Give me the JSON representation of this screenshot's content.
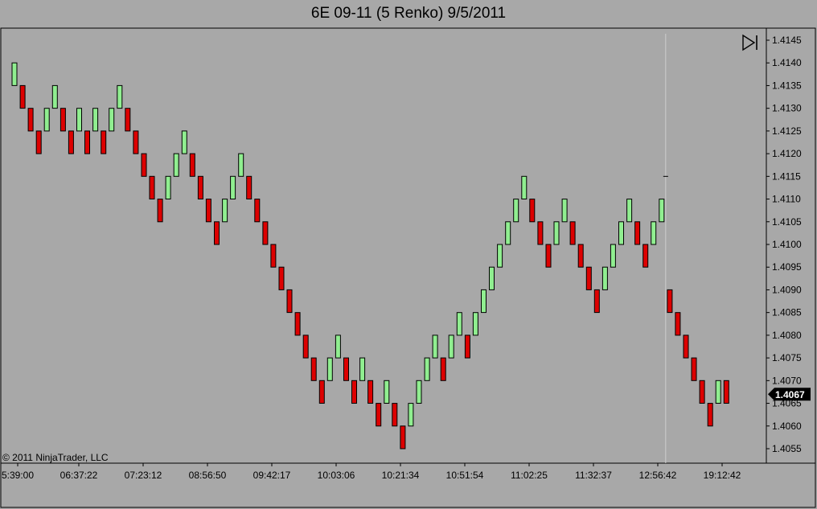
{
  "title": "6E 09-11 (5 Renko)  9/5/2011",
  "copyright": "© 2011 NinjaTrader, LLC",
  "colors": {
    "background": "#a8a8a8",
    "up_brick": "#90ee90",
    "down_brick": "#dd0000",
    "outline": "#000000",
    "price_marker_bg": "#000000",
    "price_marker_text": "#ffffff"
  },
  "icons": {
    "scroll_end": "scroll-to-end-icon"
  },
  "chart_data": {
    "type": "renko",
    "brick_size": 0.0005,
    "ylim": [
      1.4052,
      1.4147
    ],
    "y_ticks": [
      "1.4145",
      "1.4140",
      "1.4135",
      "1.4130",
      "1.4125",
      "1.4120",
      "1.4115",
      "1.4110",
      "1.4105",
      "1.4100",
      "1.4095",
      "1.4090",
      "1.4085",
      "1.4080",
      "1.4075",
      "1.4070",
      "1.4065",
      "1.4060",
      "1.4055"
    ],
    "x_ticks": [
      "5:39:00",
      "06:37:22",
      "07:23:12",
      "08:56:50",
      "09:42:17",
      "10:03:06",
      "10:21:34",
      "10:51:54",
      "11:02:25",
      "11:32:37",
      "12:56:42",
      "19:12:42"
    ],
    "session_break_after_brick": 81,
    "last_price": "1.4067",
    "bricks": [
      {
        "low": 1.4135,
        "high": 1.414,
        "dir": "up"
      },
      {
        "low": 1.413,
        "high": 1.4135,
        "dir": "down"
      },
      {
        "low": 1.4125,
        "high": 1.413,
        "dir": "down"
      },
      {
        "low": 1.412,
        "high": 1.4125,
        "dir": "down"
      },
      {
        "low": 1.4125,
        "high": 1.413,
        "dir": "up"
      },
      {
        "low": 1.413,
        "high": 1.4135,
        "dir": "up"
      },
      {
        "low": 1.4125,
        "high": 1.413,
        "dir": "down"
      },
      {
        "low": 1.412,
        "high": 1.4125,
        "dir": "down"
      },
      {
        "low": 1.4125,
        "high": 1.413,
        "dir": "up"
      },
      {
        "low": 1.412,
        "high": 1.4125,
        "dir": "down"
      },
      {
        "low": 1.4125,
        "high": 1.413,
        "dir": "up"
      },
      {
        "low": 1.412,
        "high": 1.4125,
        "dir": "down"
      },
      {
        "low": 1.4125,
        "high": 1.413,
        "dir": "up"
      },
      {
        "low": 1.413,
        "high": 1.4135,
        "dir": "up"
      },
      {
        "low": 1.4125,
        "high": 1.413,
        "dir": "down"
      },
      {
        "low": 1.412,
        "high": 1.4125,
        "dir": "down"
      },
      {
        "low": 1.4115,
        "high": 1.412,
        "dir": "down"
      },
      {
        "low": 1.411,
        "high": 1.4115,
        "dir": "down"
      },
      {
        "low": 1.4105,
        "high": 1.411,
        "dir": "down"
      },
      {
        "low": 1.411,
        "high": 1.4115,
        "dir": "up"
      },
      {
        "low": 1.4115,
        "high": 1.412,
        "dir": "up"
      },
      {
        "low": 1.412,
        "high": 1.4125,
        "dir": "up"
      },
      {
        "low": 1.4115,
        "high": 1.412,
        "dir": "down"
      },
      {
        "low": 1.411,
        "high": 1.4115,
        "dir": "down"
      },
      {
        "low": 1.4105,
        "high": 1.411,
        "dir": "down"
      },
      {
        "low": 1.41,
        "high": 1.4105,
        "dir": "down"
      },
      {
        "low": 1.4105,
        "high": 1.411,
        "dir": "up"
      },
      {
        "low": 1.411,
        "high": 1.4115,
        "dir": "up"
      },
      {
        "low": 1.4115,
        "high": 1.412,
        "dir": "up"
      },
      {
        "low": 1.411,
        "high": 1.4115,
        "dir": "down"
      },
      {
        "low": 1.4105,
        "high": 1.411,
        "dir": "down"
      },
      {
        "low": 1.41,
        "high": 1.4105,
        "dir": "down"
      },
      {
        "low": 1.4095,
        "high": 1.41,
        "dir": "down"
      },
      {
        "low": 1.409,
        "high": 1.4095,
        "dir": "down"
      },
      {
        "low": 1.4085,
        "high": 1.409,
        "dir": "down"
      },
      {
        "low": 1.408,
        "high": 1.4085,
        "dir": "down"
      },
      {
        "low": 1.4075,
        "high": 1.408,
        "dir": "down"
      },
      {
        "low": 1.407,
        "high": 1.4075,
        "dir": "down"
      },
      {
        "low": 1.4065,
        "high": 1.407,
        "dir": "down"
      },
      {
        "low": 1.407,
        "high": 1.4075,
        "dir": "up"
      },
      {
        "low": 1.4075,
        "high": 1.408,
        "dir": "up"
      },
      {
        "low": 1.407,
        "high": 1.4075,
        "dir": "down"
      },
      {
        "low": 1.4065,
        "high": 1.407,
        "dir": "down"
      },
      {
        "low": 1.407,
        "high": 1.4075,
        "dir": "up"
      },
      {
        "low": 1.4065,
        "high": 1.407,
        "dir": "down"
      },
      {
        "low": 1.406,
        "high": 1.4065,
        "dir": "down"
      },
      {
        "low": 1.4065,
        "high": 1.407,
        "dir": "up"
      },
      {
        "low": 1.406,
        "high": 1.4065,
        "dir": "down"
      },
      {
        "low": 1.4055,
        "high": 1.406,
        "dir": "down"
      },
      {
        "low": 1.406,
        "high": 1.4065,
        "dir": "up"
      },
      {
        "low": 1.4065,
        "high": 1.407,
        "dir": "up"
      },
      {
        "low": 1.407,
        "high": 1.4075,
        "dir": "up"
      },
      {
        "low": 1.4075,
        "high": 1.408,
        "dir": "up"
      },
      {
        "low": 1.407,
        "high": 1.4075,
        "dir": "down"
      },
      {
        "low": 1.4075,
        "high": 1.408,
        "dir": "up"
      },
      {
        "low": 1.408,
        "high": 1.4085,
        "dir": "up"
      },
      {
        "low": 1.4075,
        "high": 1.408,
        "dir": "down"
      },
      {
        "low": 1.408,
        "high": 1.4085,
        "dir": "up"
      },
      {
        "low": 1.4085,
        "high": 1.409,
        "dir": "up"
      },
      {
        "low": 1.409,
        "high": 1.4095,
        "dir": "up"
      },
      {
        "low": 1.4095,
        "high": 1.41,
        "dir": "up"
      },
      {
        "low": 1.41,
        "high": 1.4105,
        "dir": "up"
      },
      {
        "low": 1.4105,
        "high": 1.411,
        "dir": "up"
      },
      {
        "low": 1.411,
        "high": 1.4115,
        "dir": "up"
      },
      {
        "low": 1.4105,
        "high": 1.411,
        "dir": "down"
      },
      {
        "low": 1.41,
        "high": 1.4105,
        "dir": "down"
      },
      {
        "low": 1.4095,
        "high": 1.41,
        "dir": "down"
      },
      {
        "low": 1.41,
        "high": 1.4105,
        "dir": "up"
      },
      {
        "low": 1.4105,
        "high": 1.411,
        "dir": "up"
      },
      {
        "low": 1.41,
        "high": 1.4105,
        "dir": "down"
      },
      {
        "low": 1.4095,
        "high": 1.41,
        "dir": "down"
      },
      {
        "low": 1.409,
        "high": 1.4095,
        "dir": "down"
      },
      {
        "low": 1.4085,
        "high": 1.409,
        "dir": "down"
      },
      {
        "low": 1.409,
        "high": 1.4095,
        "dir": "up"
      },
      {
        "low": 1.4095,
        "high": 1.41,
        "dir": "up"
      },
      {
        "low": 1.41,
        "high": 1.4105,
        "dir": "up"
      },
      {
        "low": 1.4105,
        "high": 1.411,
        "dir": "up"
      },
      {
        "low": 1.41,
        "high": 1.4105,
        "dir": "down"
      },
      {
        "low": 1.4095,
        "high": 1.41,
        "dir": "down"
      },
      {
        "low": 1.41,
        "high": 1.4105,
        "dir": "up"
      },
      {
        "low": 1.4105,
        "high": 1.411,
        "dir": "up"
      },
      {
        "low": 1.4085,
        "high": 1.409,
        "dir": "down"
      },
      {
        "low": 1.408,
        "high": 1.4085,
        "dir": "down"
      },
      {
        "low": 1.4075,
        "high": 1.408,
        "dir": "down"
      },
      {
        "low": 1.407,
        "high": 1.4075,
        "dir": "down"
      },
      {
        "low": 1.4065,
        "high": 1.407,
        "dir": "down"
      },
      {
        "low": 1.406,
        "high": 1.4065,
        "dir": "down"
      },
      {
        "low": 1.4065,
        "high": 1.407,
        "dir": "up"
      },
      {
        "low": 1.4065,
        "high": 1.407,
        "dir": "down"
      }
    ]
  }
}
